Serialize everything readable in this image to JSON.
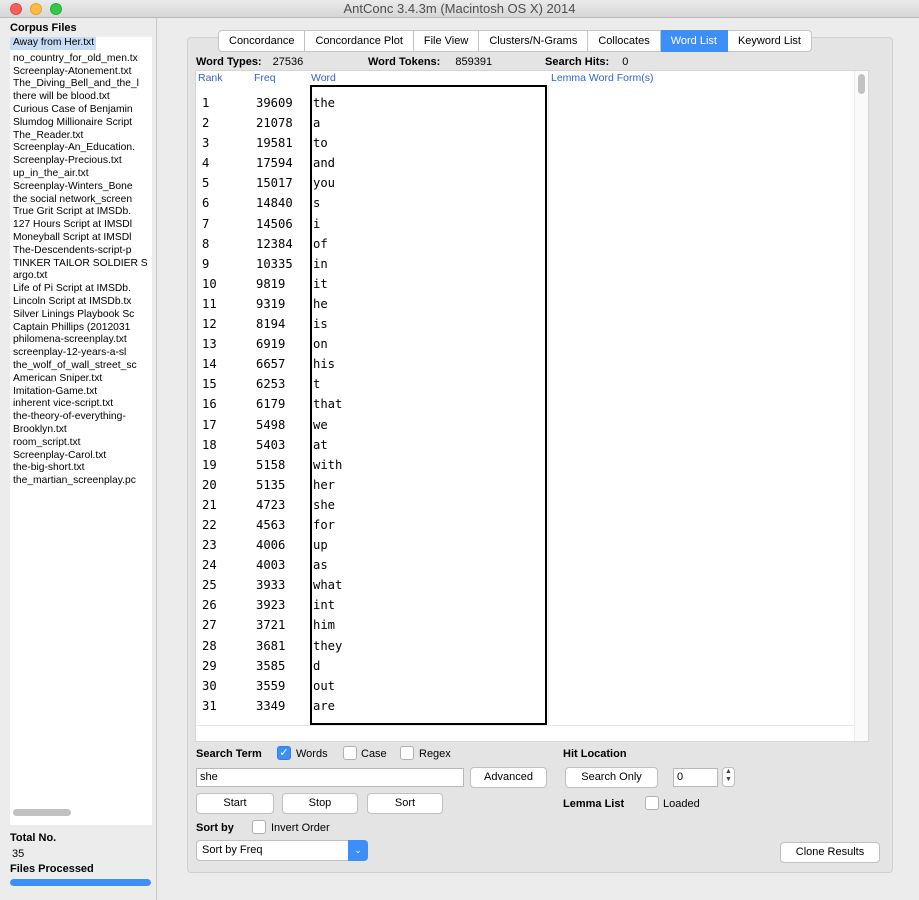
{
  "window": {
    "title": "AntConc 3.4.3m (Macintosh OS X) 2014"
  },
  "corpus": {
    "header": "Corpus Files",
    "selected_index": 0,
    "files": [
      "Away from Her.txt",
      "no_country_for_old_men.tx",
      "Screenplay-Atonement.txt",
      "The_Diving_Bell_and_the_l",
      "there will be blood.txt",
      "Curious Case of Benjamin",
      "Slumdog Millionaire Script",
      "The_Reader.txt",
      "Screenplay-An_Education.",
      "Screenplay-Precious.txt",
      "up_in_the_air.txt",
      "Screenplay-Winters_Bone",
      "the social network_screen",
      "True Grit Script at IMSDb.",
      "127 Hours Script at IMSDl",
      "Moneyball Script at IMSDl",
      "The-Descendents-script-p",
      "TINKER TAILOR SOLDIER S",
      "argo.txt",
      "Life of Pi Script at IMSDb.",
      "Lincoln Script at IMSDb.tx",
      "Silver Linings Playbook Sc",
      "Captain Phillips (2012031",
      "philomena-screenplay.txt",
      "screenplay-12-years-a-sl",
      "the_wolf_of_wall_street_sc",
      "American Sniper.txt",
      "Imitation-Game.txt",
      "inherent vice-script.txt",
      "the-theory-of-everything-",
      "Brooklyn.txt",
      "room_script.txt",
      "Screenplay-Carol.txt",
      "the-big-short.txt",
      "the_martian_screenplay.pc"
    ],
    "total_label": "Total No.",
    "total_value": "35",
    "processed_label": "Files Processed",
    "processed_fraction": 1.0
  },
  "tabs": [
    {
      "label": "Concordance",
      "active": false
    },
    {
      "label": "Concordance Plot",
      "active": false
    },
    {
      "label": "File View",
      "active": false
    },
    {
      "label": "Clusters/N-Grams",
      "active": false
    },
    {
      "label": "Collocates",
      "active": false
    },
    {
      "label": "Word List",
      "active": true
    },
    {
      "label": "Keyword List",
      "active": false
    }
  ],
  "stats": {
    "word_types_label": "Word Types:",
    "word_types_value": "27536",
    "word_tokens_label": "Word Tokens:",
    "word_tokens_value": "859391",
    "search_hits_label": "Search Hits:",
    "search_hits_value": "0"
  },
  "table": {
    "headers": {
      "rank": "Rank",
      "freq": "Freq",
      "word": "Word",
      "lemma": "Lemma Word Form(s)"
    },
    "rows": [
      [
        "1",
        "39609",
        "the"
      ],
      [
        "2",
        "21078",
        "a"
      ],
      [
        "3",
        "19581",
        "to"
      ],
      [
        "4",
        "17594",
        "and"
      ],
      [
        "5",
        "15017",
        "you"
      ],
      [
        "6",
        "14840",
        "s"
      ],
      [
        "7",
        "14506",
        "i"
      ],
      [
        "8",
        "12384",
        "of"
      ],
      [
        "9",
        "10335",
        "in"
      ],
      [
        "10",
        "9819",
        "it"
      ],
      [
        "11",
        "9319",
        "he"
      ],
      [
        "12",
        "8194",
        "is"
      ],
      [
        "13",
        "6919",
        "on"
      ],
      [
        "14",
        "6657",
        "his"
      ],
      [
        "15",
        "6253",
        "t"
      ],
      [
        "16",
        "6179",
        "that"
      ],
      [
        "17",
        "5498",
        "we"
      ],
      [
        "18",
        "5403",
        "at"
      ],
      [
        "19",
        "5158",
        "with"
      ],
      [
        "20",
        "5135",
        "her"
      ],
      [
        "21",
        "4723",
        "she"
      ],
      [
        "22",
        "4563",
        "for"
      ],
      [
        "23",
        "4006",
        "up"
      ],
      [
        "24",
        "4003",
        "as"
      ],
      [
        "25",
        "3933",
        "what"
      ],
      [
        "26",
        "3923",
        "int"
      ],
      [
        "27",
        "3721",
        "him"
      ],
      [
        "28",
        "3681",
        "they"
      ],
      [
        "29",
        "3585",
        "d"
      ],
      [
        "30",
        "3559",
        "out"
      ],
      [
        "31",
        "3349",
        "are"
      ]
    ]
  },
  "search": {
    "term_label": "Search Term",
    "words_label": "Words",
    "words_checked": true,
    "case_label": "Case",
    "case_checked": false,
    "regex_label": "Regex",
    "regex_checked": false,
    "term_value": "she",
    "advanced_label": "Advanced",
    "start_label": "Start",
    "stop_label": "Stop",
    "sort_label": "Sort",
    "sort_by_label": "Sort by",
    "invert_label": "Invert Order",
    "invert_checked": false,
    "sort_select_value": "Sort by Freq"
  },
  "hit_location": {
    "label": "Hit Location",
    "search_only_label": "Search Only",
    "position_value": "0"
  },
  "lemma": {
    "label": "Lemma List",
    "loaded_label": "Loaded",
    "loaded_checked": false
  },
  "clone_label": "Clone Results",
  "colors": {
    "accent": "#3d8ef7",
    "header_text": "#2e62d9"
  }
}
